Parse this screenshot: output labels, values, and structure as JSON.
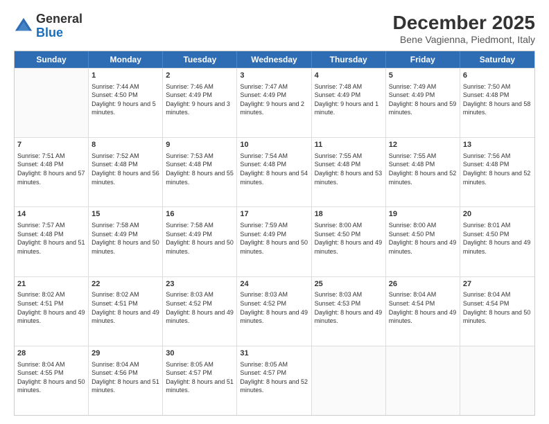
{
  "logo": {
    "general": "General",
    "blue": "Blue"
  },
  "title": "December 2025",
  "subtitle": "Bene Vagienna, Piedmont, Italy",
  "days_of_week": [
    "Sunday",
    "Monday",
    "Tuesday",
    "Wednesday",
    "Thursday",
    "Friday",
    "Saturday"
  ],
  "weeks": [
    [
      {
        "day": "",
        "sunrise": "",
        "sunset": "",
        "daylight": ""
      },
      {
        "day": "1",
        "sunrise": "Sunrise: 7:44 AM",
        "sunset": "Sunset: 4:50 PM",
        "daylight": "Daylight: 9 hours and 5 minutes."
      },
      {
        "day": "2",
        "sunrise": "Sunrise: 7:46 AM",
        "sunset": "Sunset: 4:49 PM",
        "daylight": "Daylight: 9 hours and 3 minutes."
      },
      {
        "day": "3",
        "sunrise": "Sunrise: 7:47 AM",
        "sunset": "Sunset: 4:49 PM",
        "daylight": "Daylight: 9 hours and 2 minutes."
      },
      {
        "day": "4",
        "sunrise": "Sunrise: 7:48 AM",
        "sunset": "Sunset: 4:49 PM",
        "daylight": "Daylight: 9 hours and 1 minute."
      },
      {
        "day": "5",
        "sunrise": "Sunrise: 7:49 AM",
        "sunset": "Sunset: 4:49 PM",
        "daylight": "Daylight: 8 hours and 59 minutes."
      },
      {
        "day": "6",
        "sunrise": "Sunrise: 7:50 AM",
        "sunset": "Sunset: 4:48 PM",
        "daylight": "Daylight: 8 hours and 58 minutes."
      }
    ],
    [
      {
        "day": "7",
        "sunrise": "Sunrise: 7:51 AM",
        "sunset": "Sunset: 4:48 PM",
        "daylight": "Daylight: 8 hours and 57 minutes."
      },
      {
        "day": "8",
        "sunrise": "Sunrise: 7:52 AM",
        "sunset": "Sunset: 4:48 PM",
        "daylight": "Daylight: 8 hours and 56 minutes."
      },
      {
        "day": "9",
        "sunrise": "Sunrise: 7:53 AM",
        "sunset": "Sunset: 4:48 PM",
        "daylight": "Daylight: 8 hours and 55 minutes."
      },
      {
        "day": "10",
        "sunrise": "Sunrise: 7:54 AM",
        "sunset": "Sunset: 4:48 PM",
        "daylight": "Daylight: 8 hours and 54 minutes."
      },
      {
        "day": "11",
        "sunrise": "Sunrise: 7:55 AM",
        "sunset": "Sunset: 4:48 PM",
        "daylight": "Daylight: 8 hours and 53 minutes."
      },
      {
        "day": "12",
        "sunrise": "Sunrise: 7:55 AM",
        "sunset": "Sunset: 4:48 PM",
        "daylight": "Daylight: 8 hours and 52 minutes."
      },
      {
        "day": "13",
        "sunrise": "Sunrise: 7:56 AM",
        "sunset": "Sunset: 4:48 PM",
        "daylight": "Daylight: 8 hours and 52 minutes."
      }
    ],
    [
      {
        "day": "14",
        "sunrise": "Sunrise: 7:57 AM",
        "sunset": "Sunset: 4:48 PM",
        "daylight": "Daylight: 8 hours and 51 minutes."
      },
      {
        "day": "15",
        "sunrise": "Sunrise: 7:58 AM",
        "sunset": "Sunset: 4:49 PM",
        "daylight": "Daylight: 8 hours and 50 minutes."
      },
      {
        "day": "16",
        "sunrise": "Sunrise: 7:58 AM",
        "sunset": "Sunset: 4:49 PM",
        "daylight": "Daylight: 8 hours and 50 minutes."
      },
      {
        "day": "17",
        "sunrise": "Sunrise: 7:59 AM",
        "sunset": "Sunset: 4:49 PM",
        "daylight": "Daylight: 8 hours and 50 minutes."
      },
      {
        "day": "18",
        "sunrise": "Sunrise: 8:00 AM",
        "sunset": "Sunset: 4:50 PM",
        "daylight": "Daylight: 8 hours and 49 minutes."
      },
      {
        "day": "19",
        "sunrise": "Sunrise: 8:00 AM",
        "sunset": "Sunset: 4:50 PM",
        "daylight": "Daylight: 8 hours and 49 minutes."
      },
      {
        "day": "20",
        "sunrise": "Sunrise: 8:01 AM",
        "sunset": "Sunset: 4:50 PM",
        "daylight": "Daylight: 8 hours and 49 minutes."
      }
    ],
    [
      {
        "day": "21",
        "sunrise": "Sunrise: 8:02 AM",
        "sunset": "Sunset: 4:51 PM",
        "daylight": "Daylight: 8 hours and 49 minutes."
      },
      {
        "day": "22",
        "sunrise": "Sunrise: 8:02 AM",
        "sunset": "Sunset: 4:51 PM",
        "daylight": "Daylight: 8 hours and 49 minutes."
      },
      {
        "day": "23",
        "sunrise": "Sunrise: 8:03 AM",
        "sunset": "Sunset: 4:52 PM",
        "daylight": "Daylight: 8 hours and 49 minutes."
      },
      {
        "day": "24",
        "sunrise": "Sunrise: 8:03 AM",
        "sunset": "Sunset: 4:52 PM",
        "daylight": "Daylight: 8 hours and 49 minutes."
      },
      {
        "day": "25",
        "sunrise": "Sunrise: 8:03 AM",
        "sunset": "Sunset: 4:53 PM",
        "daylight": "Daylight: 8 hours and 49 minutes."
      },
      {
        "day": "26",
        "sunrise": "Sunrise: 8:04 AM",
        "sunset": "Sunset: 4:54 PM",
        "daylight": "Daylight: 8 hours and 49 minutes."
      },
      {
        "day": "27",
        "sunrise": "Sunrise: 8:04 AM",
        "sunset": "Sunset: 4:54 PM",
        "daylight": "Daylight: 8 hours and 50 minutes."
      }
    ],
    [
      {
        "day": "28",
        "sunrise": "Sunrise: 8:04 AM",
        "sunset": "Sunset: 4:55 PM",
        "daylight": "Daylight: 8 hours and 50 minutes."
      },
      {
        "day": "29",
        "sunrise": "Sunrise: 8:04 AM",
        "sunset": "Sunset: 4:56 PM",
        "daylight": "Daylight: 8 hours and 51 minutes."
      },
      {
        "day": "30",
        "sunrise": "Sunrise: 8:05 AM",
        "sunset": "Sunset: 4:57 PM",
        "daylight": "Daylight: 8 hours and 51 minutes."
      },
      {
        "day": "31",
        "sunrise": "Sunrise: 8:05 AM",
        "sunset": "Sunset: 4:57 PM",
        "daylight": "Daylight: 8 hours and 52 minutes."
      },
      {
        "day": "",
        "sunrise": "",
        "sunset": "",
        "daylight": ""
      },
      {
        "day": "",
        "sunrise": "",
        "sunset": "",
        "daylight": ""
      },
      {
        "day": "",
        "sunrise": "",
        "sunset": "",
        "daylight": ""
      }
    ]
  ]
}
